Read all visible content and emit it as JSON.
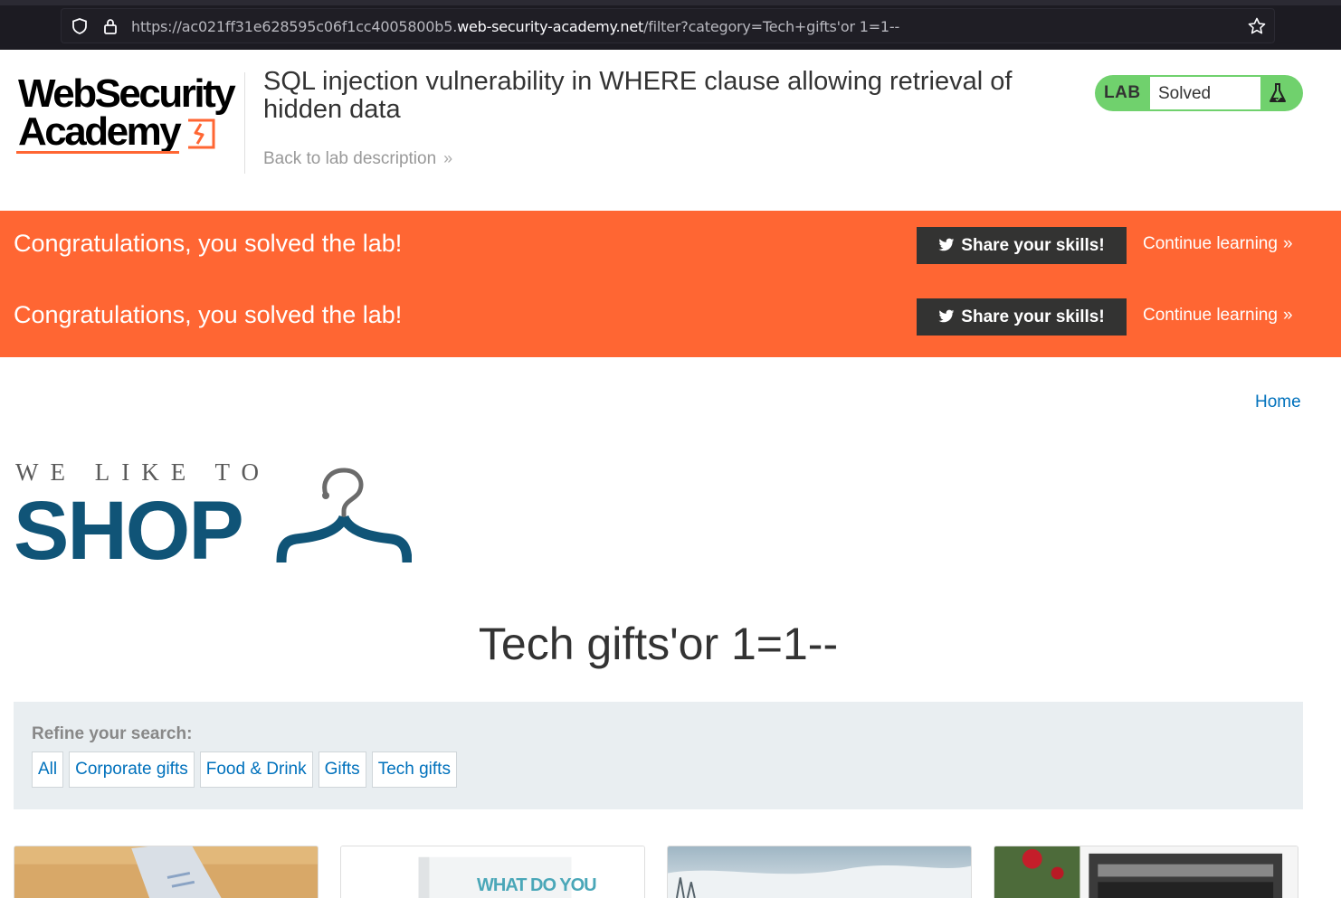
{
  "browser": {
    "url_prefix": "https://ac021ff31e628595c06f1cc4005800b5.",
    "url_host": "web-security-academy.net",
    "url_suffix": "/filter?category=Tech+gifts'or 1=1--"
  },
  "academy": {
    "logo_line1": "WebSecurity",
    "logo_line2": "Academy",
    "lab_title": "SQL injection vulnerability in WHERE clause allowing retrieval of hidden data",
    "back_link": "Back to lab description",
    "lab_badge": "LAB",
    "lab_status": "Solved"
  },
  "notices": [
    {
      "message": "Congratulations, you solved the lab!",
      "share": "Share your skills!",
      "continue": "Continue learning"
    },
    {
      "message": "Congratulations, you solved the lab!",
      "share": "Share your skills!",
      "continue": "Continue learning"
    }
  ],
  "shop": {
    "home": "Home",
    "tagline": "WE LIKE TO",
    "brand": "SHOP",
    "heading": "Tech gifts'or 1=1--",
    "refine_label": "Refine your search:",
    "categories": [
      "All",
      "Corporate gifts",
      "Food & Drink",
      "Gifts",
      "Tech gifts"
    ],
    "card_text": "WHAT DO YOU"
  },
  "colors": {
    "accent": "#ff6633",
    "shop_blue": "#105477",
    "link_blue": "#0071bc",
    "lab_green": "#70d16d"
  }
}
